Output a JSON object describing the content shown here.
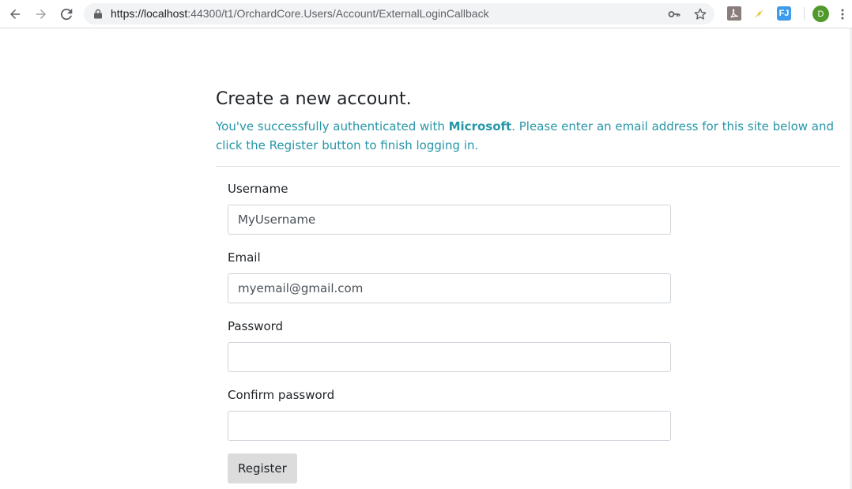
{
  "browser": {
    "url_host": "https://localhost",
    "url_path": ":44300/t1/OrchardCore.Users/Account/ExternalLoginCallback",
    "profile_initial": "D",
    "extension_fj_label": "FJ",
    "icons": {
      "back": "arrow-left-icon",
      "forward": "arrow-right-icon",
      "reload": "reload-icon",
      "lock": "lock-icon",
      "key": "key-icon",
      "star": "star-icon",
      "pdf": "pdf-extension-icon",
      "bolt": "lightning-extension-icon",
      "menu": "kebab-menu-icon"
    },
    "colors": {
      "avatar": "#4f9a2b",
      "fj_extension": "#3d9be9",
      "bolt_extension": "#e8c02e"
    }
  },
  "page": {
    "title": "Create a new account.",
    "lead_prefix": "You've successfully authenticated with ",
    "provider": "Microsoft",
    "lead_suffix": ". Please enter an email address for this site below and click the Register button to finish logging in.",
    "accent_color": "#2796a7"
  },
  "form": {
    "username": {
      "label": "Username",
      "value": "MyUsername"
    },
    "email": {
      "label": "Email",
      "value": "myemail@gmail.com"
    },
    "password": {
      "label": "Password",
      "value": ""
    },
    "confirm_password": {
      "label": "Confirm password",
      "value": ""
    },
    "register_label": "Register"
  }
}
